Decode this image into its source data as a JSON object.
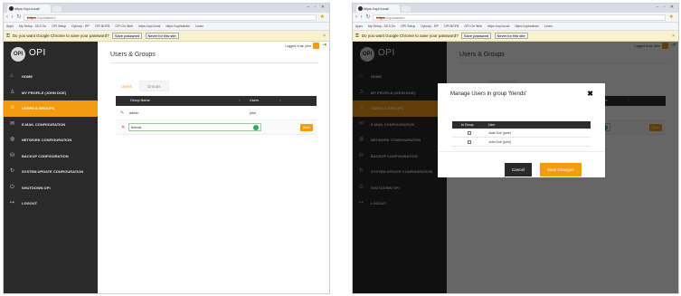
{
  "browser": {
    "tab_title": "https://opi.local/",
    "url_scheme": "https",
    "url_rest": "://opi/admin/",
    "bookmarks": [
      "Apps",
      "My Setup - 53.0 Ox",
      "OPI Setup",
      "Dyboxy - RP",
      "OPI BOFB",
      "OPI On Web",
      "https://opi.local/",
      "https://opi/admin/",
      "Learn"
    ],
    "infobar_text": "Do you want Google Chrome to save your password?",
    "save_password_label": "Save password",
    "never_label": "Never for this site"
  },
  "app": {
    "brand_name": "OPI",
    "logo_text": "OPI",
    "logged_in": "Logged in as: john",
    "menu": [
      {
        "label": "HOME",
        "icon": "home-icon",
        "glyph": "⌂"
      },
      {
        "label": "MY PROFILE (John Doe)",
        "icon": "user-icon",
        "glyph": "♙"
      },
      {
        "label": "USERS & GROUPS",
        "icon": "users-icon",
        "glyph": "☺"
      },
      {
        "label": "E-MAIL CONFIGURATION",
        "icon": "mail-icon",
        "glyph": "✉"
      },
      {
        "label": "NETWORK CONFIGURATION",
        "icon": "globe-icon",
        "glyph": "◍"
      },
      {
        "label": "BACKUP CONFIGURATION",
        "icon": "database-icon",
        "glyph": "⛁"
      },
      {
        "label": "SYSTEM UPDATE CONFIGURATION",
        "icon": "refresh-icon",
        "glyph": "↻"
      },
      {
        "label": "SHUTDOWN OPI",
        "icon": "power-icon",
        "glyph": "⏻"
      },
      {
        "label": "LOGOUT",
        "icon": "logout-icon",
        "glyph": "↦"
      }
    ],
    "page_title": "Users & Groups",
    "tabs": {
      "users": "Users",
      "groups": "Groups"
    },
    "table": {
      "col_group_name": "Group Name",
      "col_users": "Users",
      "sort_glyph": "↕",
      "rows": [
        {
          "name": "admin",
          "users": "john"
        }
      ],
      "edit_value": "friends",
      "save_label": "Save"
    }
  },
  "modal": {
    "title": "Manage Users in group 'friends'",
    "close_glyph": "✖",
    "col_in_group": "In Group",
    "col_user": "User",
    "users": [
      "Jane Doe (jane)",
      "John Doe (john)"
    ],
    "cancel_label": "Cancel",
    "save_changes_label": "Save Changes"
  },
  "colors": {
    "accent": "#f39c12",
    "sidebar": "#2a2a2a",
    "table_header": "#2d2d2d"
  }
}
